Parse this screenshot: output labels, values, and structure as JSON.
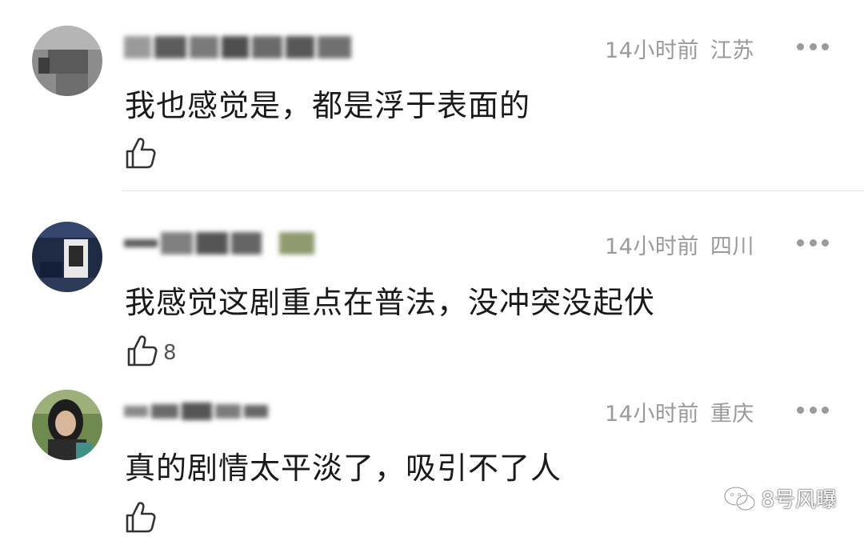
{
  "comments": [
    {
      "time": "14小时前",
      "location": "江苏",
      "text": "我也感觉是，都是浮于表面的",
      "likes": ""
    },
    {
      "time": "14小时前",
      "location": "四川",
      "text": "我感觉这剧重点在普法，没冲突没起伏",
      "likes": "8"
    },
    {
      "time": "14小时前",
      "location": "重庆",
      "text": "真的剧情太平淡了，吸引不了人",
      "likes": ""
    }
  ],
  "watermark": {
    "text": "8号风曝"
  },
  "icons": {
    "like": "thumbs-up-icon",
    "more": "more-dots-icon",
    "watermark": "wechat-icon"
  }
}
